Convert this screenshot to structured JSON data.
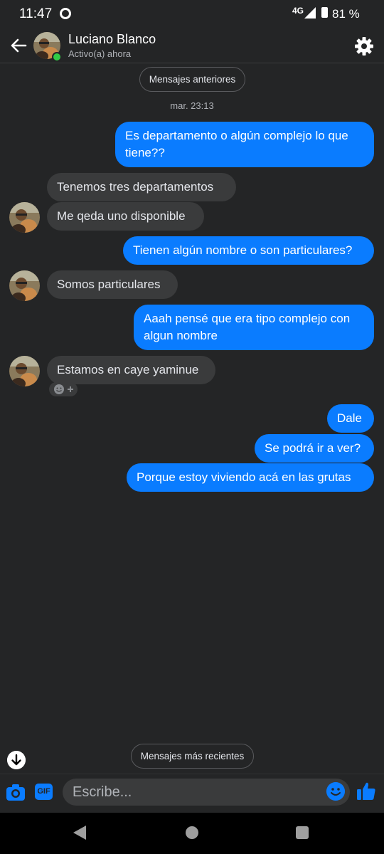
{
  "status_bar": {
    "time": "11:47",
    "network": "4G",
    "battery": "81 %"
  },
  "header": {
    "contact_name": "Luciano Blanco",
    "status": "Activo(a) ahora"
  },
  "thread": {
    "older_label": "Mensajes anteriores",
    "timestamp": "mar. 23:13",
    "newer_label": "Mensajes más recientes",
    "messages": [
      {
        "from": "me",
        "text": "Es departamento o algún complejo lo que tiene??"
      },
      {
        "from": "them",
        "text": "Tenemos tres departamentos"
      },
      {
        "from": "them",
        "text": "Me qeda uno disponible"
      },
      {
        "from": "me",
        "text": "Tienen algún nombre o son particulares?"
      },
      {
        "from": "them",
        "text": "Somos particulares"
      },
      {
        "from": "me",
        "text": "Aaah pensé que era tipo complejo con algun nombre"
      },
      {
        "from": "them",
        "text": "Estamos en caye yaminue"
      },
      {
        "from": "me",
        "text": "Dale"
      },
      {
        "from": "me",
        "text": "Se podrá ir a ver?"
      },
      {
        "from": "me",
        "text": "Porque estoy viviendo acá en las grutas"
      }
    ]
  },
  "composer": {
    "placeholder": "Escribe...",
    "gif_label": "GIF"
  },
  "icons": {
    "back": "arrow-left-icon",
    "settings": "gear-icon",
    "camera": "camera-icon",
    "emoji": "smiley-icon",
    "like": "thumbs-up-icon",
    "scroll_down": "arrow-down-icon",
    "reaction": "add-reaction-icon"
  },
  "colors": {
    "accent": "#0a7cff",
    "background": "#242526",
    "incoming_bubble": "#3a3b3c",
    "online": "#31cc46"
  }
}
